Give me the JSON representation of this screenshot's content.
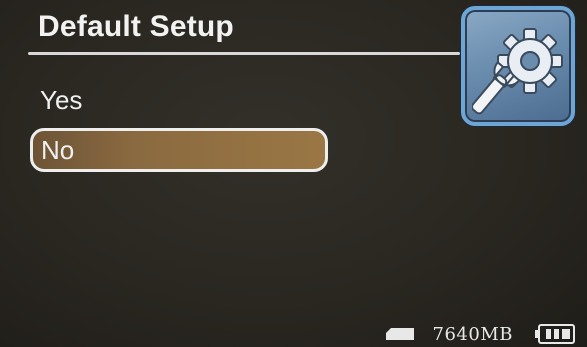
{
  "header": {
    "title": "Default Setup"
  },
  "settings_tile": {
    "icon": "settings-wrench-gear-icon"
  },
  "menu": {
    "items": [
      {
        "label": "Yes",
        "selected": false
      },
      {
        "label": "No",
        "selected": true
      }
    ]
  },
  "status": {
    "sd_card_icon": "sd-card-icon",
    "storage": "7640MB",
    "battery_icon": "battery-icon"
  },
  "colors": {
    "background": "#2a2721",
    "selection_fill": "#8a6a40",
    "tile_border": "#6fa5d3",
    "text": "#f0f0f0"
  }
}
